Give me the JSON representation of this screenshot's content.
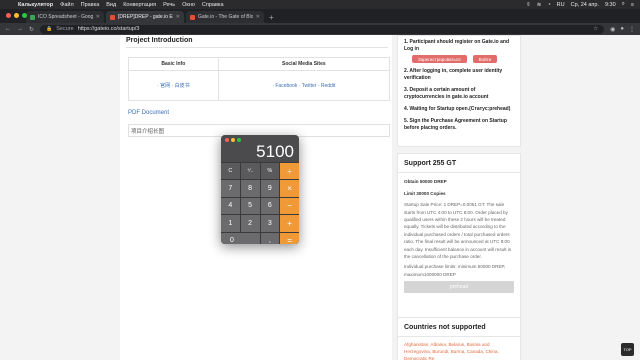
{
  "menubar": {
    "app": "Калькулятор",
    "items": [
      "Файл",
      "Правка",
      "Вид",
      "Конвертация",
      "Речь",
      "Окно",
      "Справка"
    ],
    "status": [
      "⇧",
      "≋",
      "◔",
      "RU",
      "Ср, 24 апр.",
      "9:30",
      "⌕",
      "≡"
    ]
  },
  "tabs": [
    {
      "label": "ICO Spreadsheet - Google Tab",
      "icon_color": "#34a853"
    },
    {
      "label": "[DREP]DREP - gate.io Exchange",
      "icon_color": "#e0522d"
    },
    {
      "label": "Gate.io - The Gate of Blockchain",
      "icon_color": "#e0522d"
    }
  ],
  "address": {
    "secure_label": "Secure",
    "url": "https://gateio.co/startup/3"
  },
  "main": {
    "title": "Project Introduction",
    "table": {
      "headers": [
        "Basic Info",
        "Social Media Sites"
      ],
      "basic_links": "· 官网 · 白皮书",
      "social_links": "· Facebook · Twitter · Reddit"
    },
    "pdf_link": "PDF Document",
    "image_alt": "项目介绍长图"
  },
  "steps": [
    "1. Participant should register on Gate.io and Log in",
    "2. After logging in, complete user identity verification",
    "3. Deposit a certain amount of cryptocurrencies in gate.io account",
    "4. Waiting for Startup open.(Статус:prehead)",
    "5. Sign the Purchase Agreement on Startup before placing orders."
  ],
  "register_button": "Зарегистрироваться",
  "login_button": "Войти",
  "support": {
    "title": "Support 255 GT",
    "obtain": "Obtain 50000 DREP",
    "limit": "Limit 30000 Copies",
    "description": "Startup Sale Price: 1 DREP=0.0051 GT. The sale starts from UTC 4:00 to UTC 8:00. Order placed by qualified users within these 2 hours will be treated equally. Tickets will be distributed according to the individual purchased orders / total purchased orders ratio. The final result will be announced at UTC 8:00 each day. Insufficient balance in account will result in the cancellation of the purchase order.",
    "limits": "Individual purchase limits: minimum 50000 DREP, maximum1000000 DREP",
    "button": "prehead"
  },
  "countries": {
    "title": "Countries not supported",
    "list": "Afghanistan, Albania, Belarus, Bosnia and Herzegovina, Burundi, Burma, Canada, China, Democratic Re"
  },
  "fab_label": "TOP",
  "calculator": {
    "display": "5100",
    "keys": [
      {
        "label": "C",
        "type": "fn"
      },
      {
        "label": "⁺∕₋",
        "type": "fn"
      },
      {
        "label": "%",
        "type": "fn"
      },
      {
        "label": "÷",
        "type": "op"
      },
      {
        "label": "7",
        "type": "num"
      },
      {
        "label": "8",
        "type": "num"
      },
      {
        "label": "9",
        "type": "num"
      },
      {
        "label": "×",
        "type": "op"
      },
      {
        "label": "4",
        "type": "num"
      },
      {
        "label": "5",
        "type": "num"
      },
      {
        "label": "6",
        "type": "num"
      },
      {
        "label": "−",
        "type": "op"
      },
      {
        "label": "1",
        "type": "num"
      },
      {
        "label": "2",
        "type": "num"
      },
      {
        "label": "3",
        "type": "num"
      },
      {
        "label": "+",
        "type": "op"
      },
      {
        "label": "0",
        "type": "zero"
      },
      {
        "label": ",",
        "type": "num"
      },
      {
        "label": "=",
        "type": "op"
      }
    ]
  },
  "colors": {
    "close": "#ff5f57",
    "minimize": "#febc2e",
    "zoom": "#28c840",
    "accent_orange": "#f09a37",
    "link_blue": "#3b6fb6",
    "button_red": "#e16d6a"
  }
}
